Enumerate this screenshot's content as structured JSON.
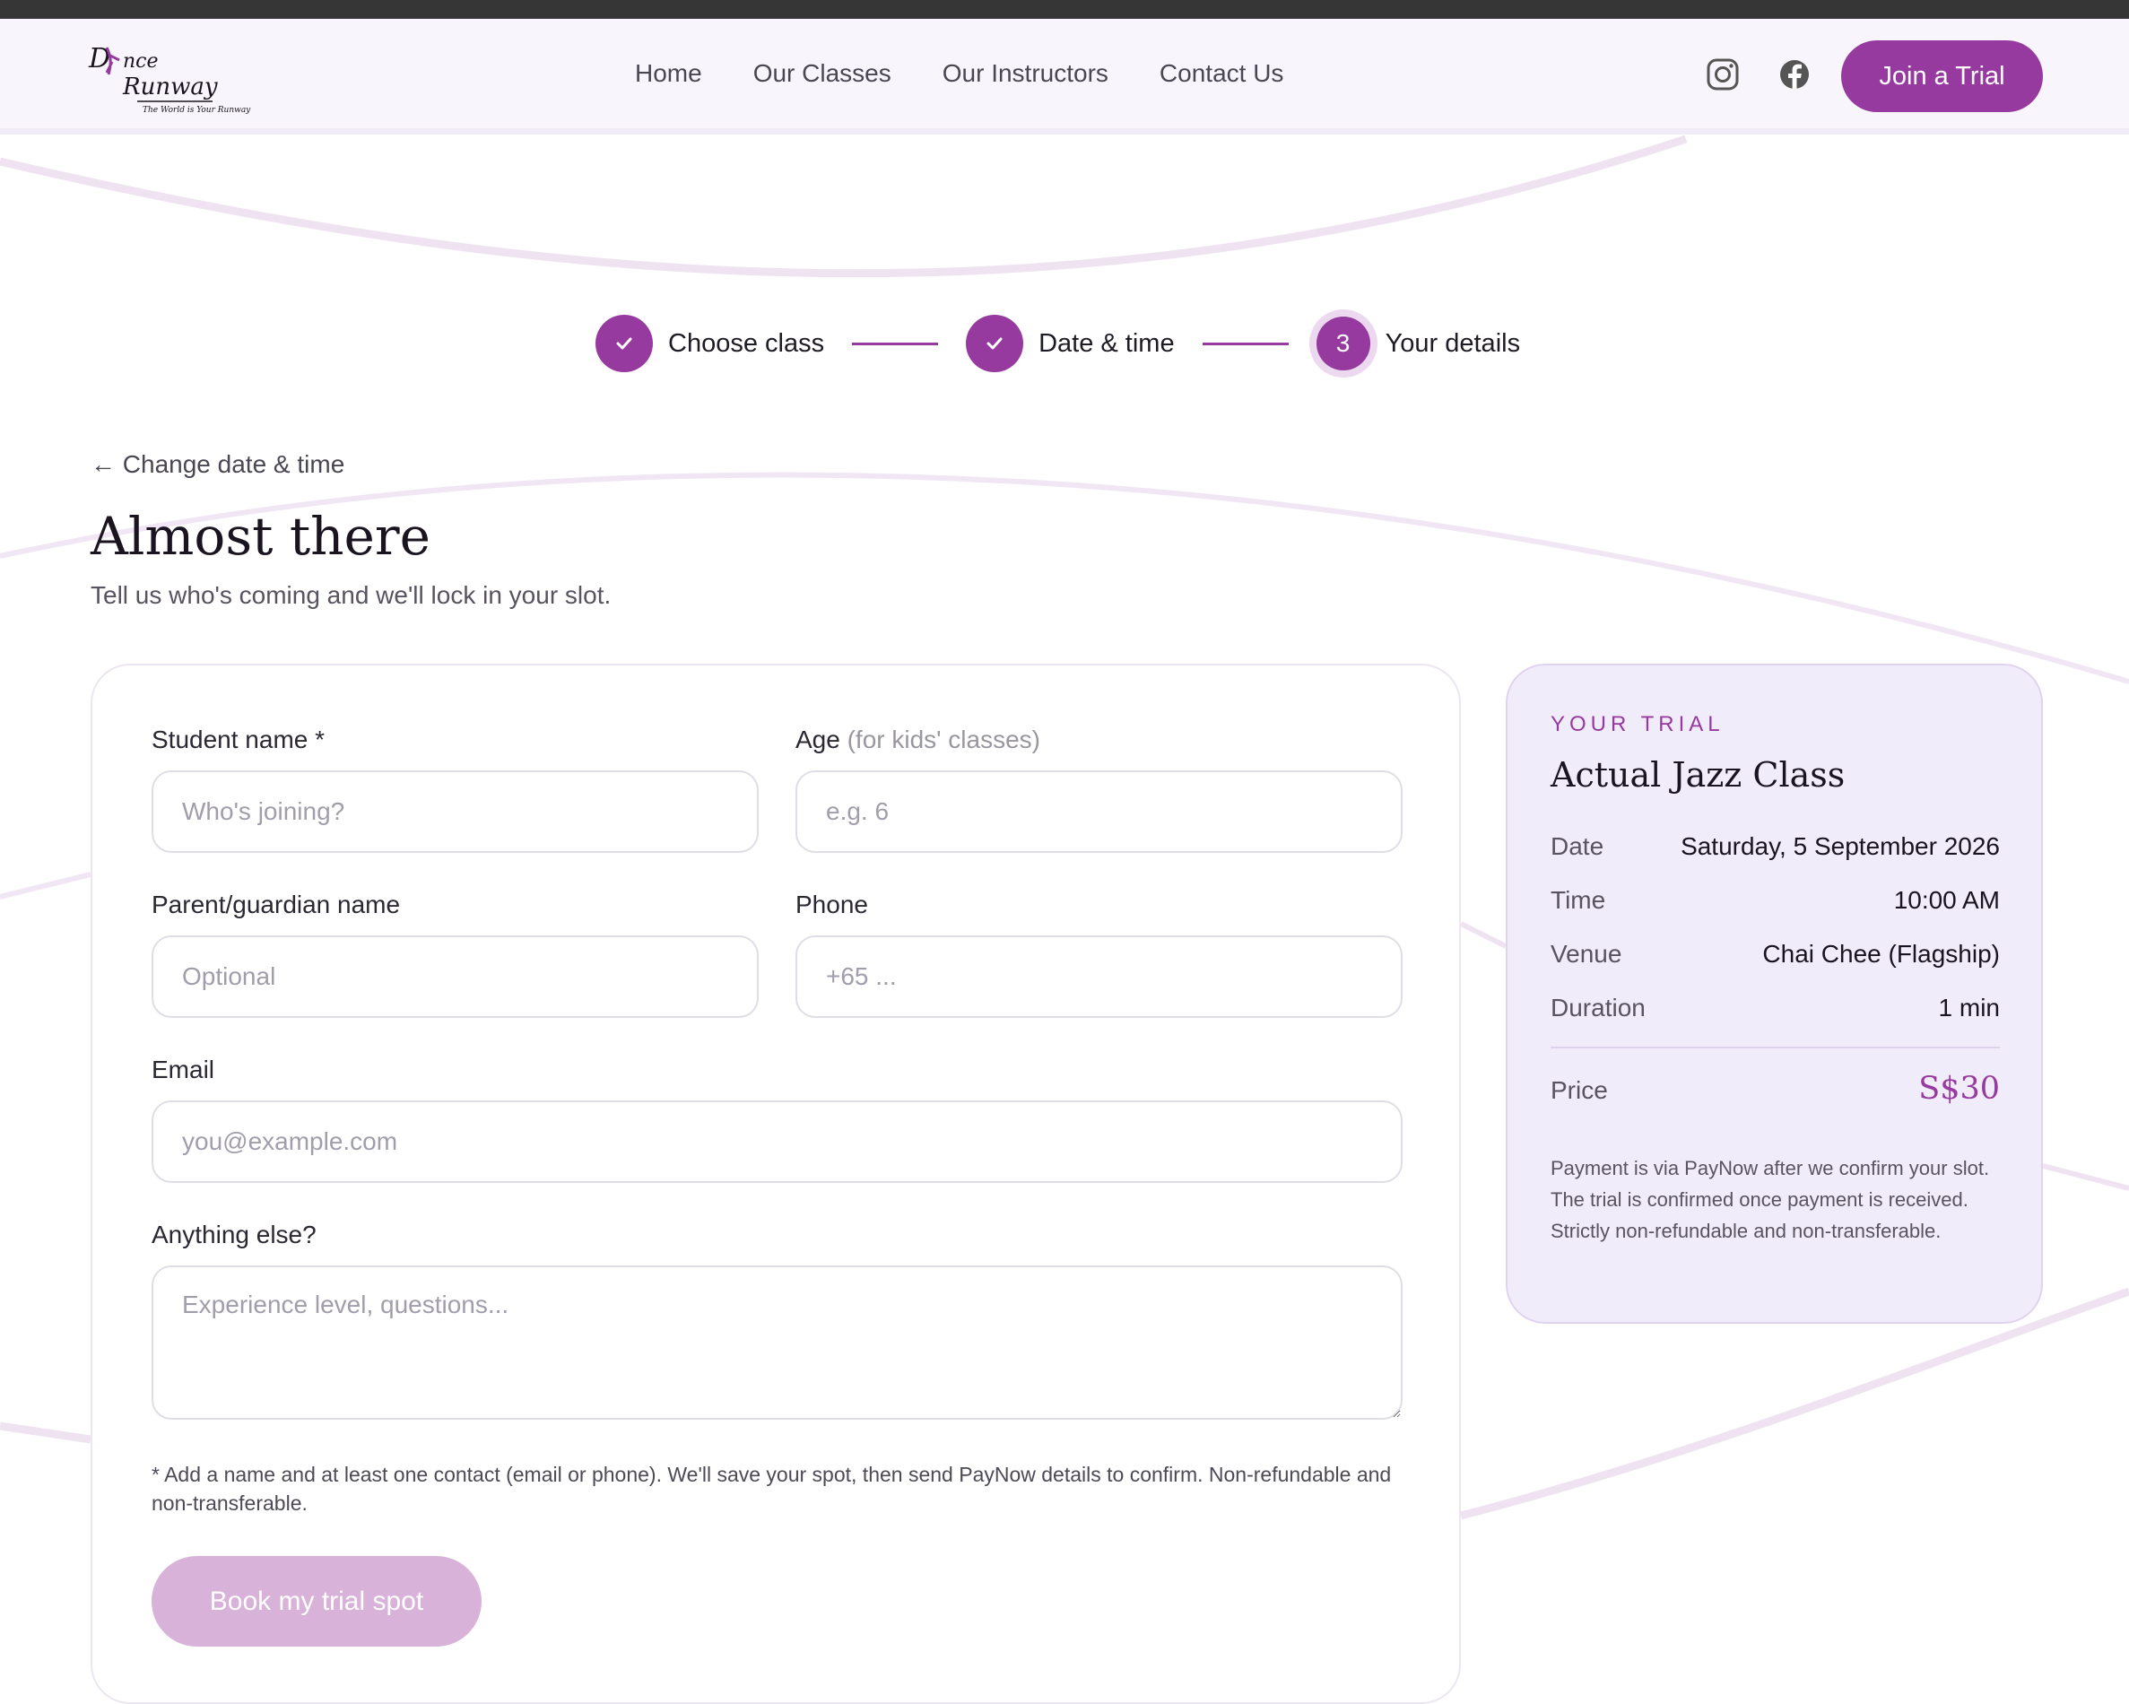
{
  "brand": {
    "logo_line1": "Dance",
    "logo_line2": "Runway",
    "logo_tagline": "The World is Your Runway",
    "accent_color": "#963a9f"
  },
  "nav": {
    "items": [
      "Home",
      "Our Classes",
      "Our Instructors",
      "Contact Us"
    ],
    "social_icons": [
      "instagram-icon",
      "facebook-icon"
    ],
    "cta_label": "Join a Trial"
  },
  "stepper": {
    "steps": [
      {
        "label": "Choose class",
        "state": "done",
        "icon": "check-icon"
      },
      {
        "label": "Date & time",
        "state": "done",
        "icon": "check-icon"
      },
      {
        "label": "Your details",
        "state": "current",
        "number": "3"
      }
    ]
  },
  "page": {
    "back_link": "← Change date & time",
    "title": "Almost there",
    "subtitle": "Tell us who's coming and we'll lock in your slot."
  },
  "form": {
    "student_name": {
      "label": "Student name *",
      "placeholder": "Who's joining?",
      "value": ""
    },
    "age": {
      "label": "Age",
      "hint": "(for kids' classes)",
      "placeholder": "e.g. 6",
      "value": ""
    },
    "guardian": {
      "label": "Parent/guardian name",
      "placeholder": "Optional",
      "value": ""
    },
    "phone": {
      "label": "Phone",
      "placeholder": "+65 ...",
      "value": ""
    },
    "email": {
      "label": "Email",
      "placeholder": "you@example.com",
      "value": ""
    },
    "notes": {
      "label": "Anything else?",
      "placeholder": "Experience level, questions...",
      "value": ""
    },
    "footnote": "* Add a name and at least one contact (email or phone). We'll save your spot, then send PayNow details to confirm. Non-refundable and non-transferable.",
    "submit_label": "Book my trial spot"
  },
  "summary": {
    "eyebrow": "YOUR TRIAL",
    "class_name": "Actual Jazz Class",
    "rows": [
      {
        "key": "Date",
        "value": "Saturday, 5 September 2026"
      },
      {
        "key": "Time",
        "value": "10:00 AM"
      },
      {
        "key": "Venue",
        "value": "Chai Chee (Flagship)"
      },
      {
        "key": "Duration",
        "value": "1 min"
      }
    ],
    "price_label": "Price",
    "price_value": "S$30",
    "payment_note": "Payment is via PayNow after we confirm your slot. The trial is confirmed once payment is received. Strictly non-refundable and non-transferable."
  }
}
